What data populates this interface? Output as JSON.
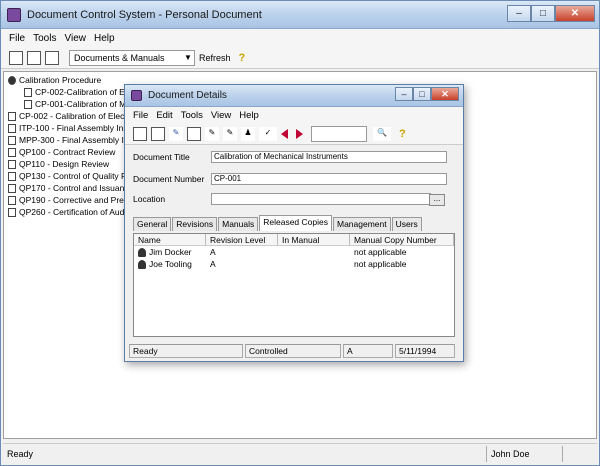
{
  "main": {
    "title": "Document Control System - Personal Document",
    "menu": [
      "File",
      "Tools",
      "View",
      "Help"
    ],
    "toolbar": {
      "combo_value": "Documents & Manuals",
      "refresh_label": "Refresh",
      "help_icon": "?"
    },
    "tree": [
      {
        "label": "Calibration Procedure",
        "level": 0
      },
      {
        "label": "CP-002-Calibration of El",
        "level": 1
      },
      {
        "label": "CP-001-Calibration of Me",
        "level": 1
      },
      {
        "label": "CP-002 - Calibration of Elect",
        "level": 0
      },
      {
        "label": "ITP-100 - Final Assembly Ins",
        "level": 0
      },
      {
        "label": "MPP-300 - Final Assembly In",
        "level": 0
      },
      {
        "label": "QP100 - Contract Review",
        "level": 0
      },
      {
        "label": "QP110 - Design Review",
        "level": 0
      },
      {
        "label": "QP130 - Control of Quality R",
        "level": 0
      },
      {
        "label": "QP170 - Control and Issuanc",
        "level": 0
      },
      {
        "label": "QP190 - Corrective and Prev",
        "level": 0
      },
      {
        "label": "QP260 - Certification of Audi",
        "level": 0
      }
    ],
    "status": {
      "left": "Ready",
      "user": "John Doe"
    }
  },
  "dialog": {
    "title": "Document Details",
    "menu": [
      "File",
      "Edit",
      "Tools",
      "View",
      "Help"
    ],
    "fields": {
      "doc_title_label": "Document Title",
      "doc_title_value": "Calibration of Mechanical Instruments",
      "doc_number_label": "Document Number",
      "doc_number_value": "CP-001",
      "location_label": "Location",
      "location_value": "",
      "browse_label": "..."
    },
    "tabs": [
      "General",
      "Revisions",
      "Manuals",
      "Released Copies",
      "Management",
      "Users"
    ],
    "active_tab": "Released Copies",
    "list": {
      "columns": [
        "Name",
        "Revision Level",
        "In Manual",
        "Manual Copy Number"
      ],
      "rows": [
        {
          "name": "Jim Docker",
          "revision": "A",
          "in_manual": "",
          "copy": "not applicable"
        },
        {
          "name": "Joe Tooling",
          "revision": "A",
          "in_manual": "",
          "copy": "not applicable"
        }
      ]
    },
    "status": {
      "state": "Ready",
      "control": "Controlled",
      "rev": "A",
      "date": "5/11/1994"
    }
  }
}
